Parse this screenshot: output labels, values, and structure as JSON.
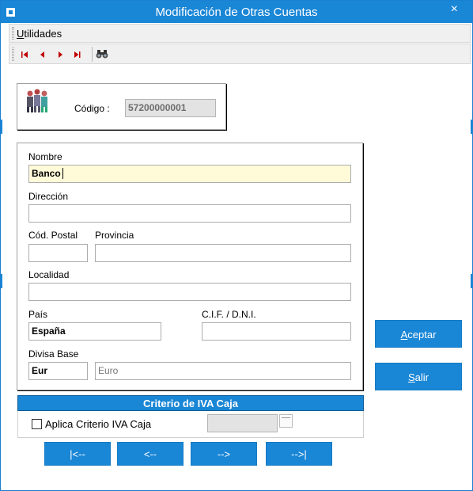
{
  "window": {
    "title": "Modificación de Otras Cuentas",
    "close_glyph": "×"
  },
  "menu": {
    "utilidades_first": "U",
    "utilidades_rest": "tilidades"
  },
  "toolbar": {
    "icons": [
      "first-record-icon",
      "previous-record-icon",
      "next-record-icon",
      "last-record-icon",
      "binoculars-icon"
    ]
  },
  "header": {
    "codigo_label": "Código :",
    "codigo_value": "57200000001",
    "icon": "people-icon"
  },
  "form": {
    "nombre_label": "Nombre",
    "nombre_value": "Banco",
    "direccion_label": "Dirección",
    "direccion_value": "",
    "cod_postal_label": "Cód. Postal",
    "cod_postal_value": "",
    "provincia_label": "Provincia",
    "provincia_value": "",
    "localidad_label": "Localidad",
    "localidad_value": "",
    "pais_label": "País",
    "pais_value": "España",
    "cif_label": "C.I.F. / D.N.I.",
    "cif_value": "",
    "divisa_label": "Divisa Base",
    "divisa_code": "Eur",
    "divisa_name": "Euro"
  },
  "iva": {
    "header": "Criterio de IVA Caja",
    "checkbox_label": "Aplica Criterio IVA Caja",
    "checked": false,
    "date_value": ""
  },
  "buttons": {
    "aceptar_first": "A",
    "aceptar_rest": "ceptar",
    "salir_first": "S",
    "salir_rest": "alir"
  },
  "nav": {
    "first": "|<--",
    "prev": "<--",
    "next": "-->",
    "last": "-->|"
  },
  "colors": {
    "accent": "#1a86d6",
    "highlight_field": "#fffbd9",
    "nav_arrow": "#c00000"
  }
}
